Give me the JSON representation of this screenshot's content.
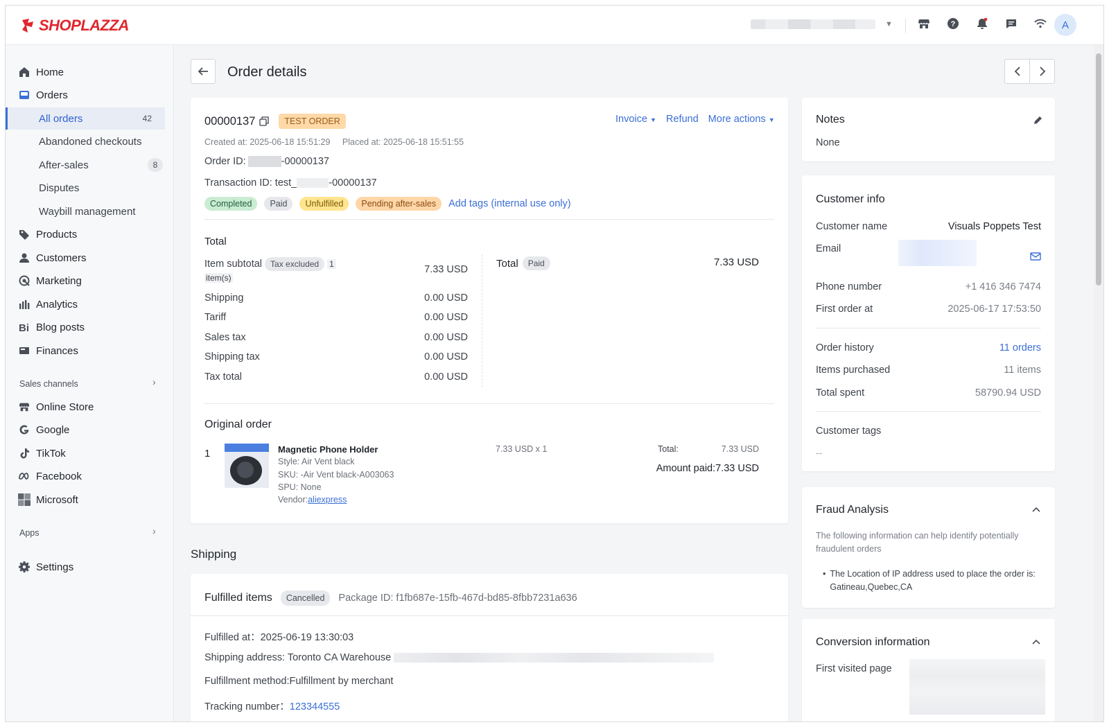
{
  "brand": {
    "name": "SHOPLAZZA",
    "color": "#e0262e"
  },
  "topbar": {
    "icons": [
      "store-icon",
      "help-icon",
      "bell-icon",
      "chat-icon",
      "wifi-icon"
    ],
    "avatar_letter": "A"
  },
  "sidebar": {
    "items": [
      {
        "label": "Home",
        "icon": "home-icon"
      },
      {
        "label": "Orders",
        "icon": "orders-icon"
      },
      {
        "label": "All orders",
        "count": "42"
      },
      {
        "label": "Abandoned checkouts"
      },
      {
        "label": "After-sales",
        "count": "8"
      },
      {
        "label": "Disputes"
      },
      {
        "label": "Waybill management"
      },
      {
        "label": "Products",
        "icon": "tag-icon"
      },
      {
        "label": "Customers",
        "icon": "person-icon"
      },
      {
        "label": "Marketing",
        "icon": "marketing-icon"
      },
      {
        "label": "Analytics",
        "icon": "bar-chart-icon"
      },
      {
        "label": "Blog posts",
        "icon": "blog-icon"
      },
      {
        "label": "Finances",
        "icon": "finance-icon"
      }
    ],
    "sales_channels_label": "Sales channels",
    "channels": [
      {
        "label": "Online Store",
        "icon": "store-icon"
      },
      {
        "label": "Google",
        "icon": "google-icon"
      },
      {
        "label": "TikTok",
        "icon": "tiktok-icon"
      },
      {
        "label": "Facebook",
        "icon": "meta-icon"
      },
      {
        "label": "Microsoft",
        "icon": "microsoft-icon"
      }
    ],
    "apps_label": "Apps",
    "settings_label": "Settings"
  },
  "page": {
    "title": "Order details"
  },
  "order": {
    "number": "00000137",
    "test_badge": "TEST ORDER",
    "actions": {
      "invoice": "Invoice",
      "refund": "Refund",
      "more": "More actions"
    },
    "created_label": "Created at:",
    "created_at": "2025-06-18 15:51:29",
    "placed_label": "Placed at:",
    "placed_at": "2025-06-18 15:51:55",
    "order_id_label": "Order ID:",
    "order_id_suffix": "-00000137",
    "transaction_label": "Transaction ID: test_",
    "transaction_suffix": "-00000137",
    "statuses": [
      "Completed",
      "Paid",
      "Unfulfilled",
      "Pending after-sales"
    ],
    "add_tags": "Add tags (internal use only)"
  },
  "totals": {
    "heading": "Total",
    "item_subtotal_label": "Item subtotal",
    "tax_excluded": "Tax excluded",
    "item_count_1": "1",
    "item_count_2": "item(s)",
    "item_subtotal": "7.33 USD",
    "rows": [
      {
        "label": "Shipping",
        "value": "0.00 USD"
      },
      {
        "label": "Tariff",
        "value": "0.00 USD"
      },
      {
        "label": "Sales tax",
        "value": "0.00 USD"
      },
      {
        "label": "Shipping tax",
        "value": "0.00 USD"
      },
      {
        "label": "Tax total",
        "value": "0.00 USD"
      }
    ],
    "total_label": "Total",
    "total_badge": "Paid",
    "total_value": "7.33 USD"
  },
  "original_order": {
    "heading": "Original order",
    "index": "1",
    "name": "Magnetic Phone Holder",
    "style": "Style: Air Vent black",
    "sku": "SKU: -Air Vent black-A003063",
    "spu": "SPU: None",
    "vendor_label": "Vendor:",
    "vendor": "aliexpress",
    "price_qty": "7.33 USD x 1",
    "total_label": "Total:",
    "total_value": "7.33 USD",
    "amount_paid": "Amount paid:7.33 USD",
    "thumb_text": "Style 2: Air Vent Mode\nColor: Black"
  },
  "shipping": {
    "heading": "Shipping",
    "fulfilled_items": "Fulfilled items",
    "cancelled": "Cancelled",
    "package": "Package ID: f1fb687e-15fb-467d-bd85-8fbb7231a636",
    "fulfilled_at": "Fulfilled at：2025-06-19 13:30:03",
    "address": "Shipping address: Toronto CA Warehouse",
    "method": "Fulfillment method:Fulfillment by merchant",
    "tracking_label": "Tracking number：",
    "tracking": "123344555"
  },
  "notes": {
    "heading": "Notes",
    "value": "None"
  },
  "customer": {
    "heading": "Customer info",
    "name_label": "Customer name",
    "name": "Visuals Poppets Test",
    "email_label": "Email",
    "phone_label": "Phone number",
    "phone": "+1 416 346 7474",
    "first_order_label": "First order at",
    "first_order": "2025-06-17 17:53:50",
    "history_label": "Order history",
    "history": "11 orders",
    "items_label": "Items purchased",
    "items": "11 items",
    "spent_label": "Total spent",
    "spent": "58790.94 USD",
    "tags_label": "Customer tags",
    "tags": "--"
  },
  "fraud": {
    "heading": "Fraud Analysis",
    "desc": "The following information can help identify potentially fraudulent orders",
    "bullet": "The Location of IP address used to place the order is: Gatineau,Quebec,CA"
  },
  "conversion": {
    "heading": "Conversion information",
    "first_visited": "First visited page"
  },
  "colors": {
    "accent": "#3b6fd6",
    "completed": "#c9ecd3",
    "paid": "#e6e8ec",
    "unfulfilled": "#ffe58f",
    "pending": "#ffd6a8",
    "test": "#ffd9a8"
  }
}
